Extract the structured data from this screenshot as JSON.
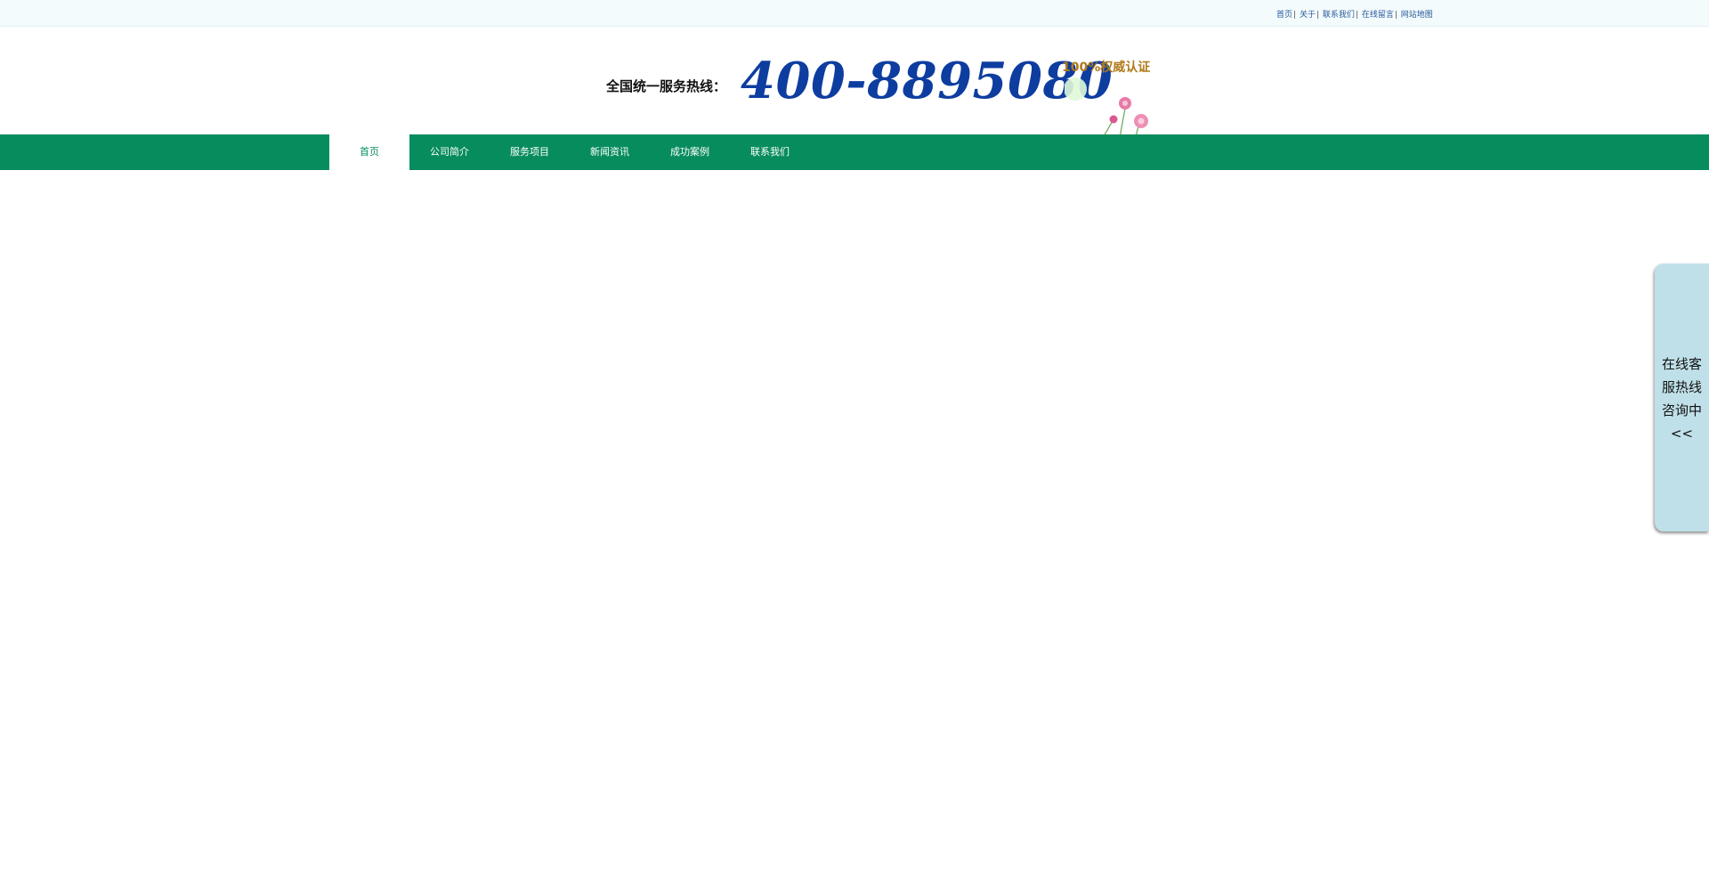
{
  "top_links": [
    "首页",
    "关于",
    "联系我们",
    "在线留言",
    "网站地图"
  ],
  "header": {
    "hotline_label": "全国统一服务热线：",
    "hotline_number": "400-8895080",
    "certification": "100%权威认证"
  },
  "nav": {
    "items": [
      {
        "label": "首页"
      },
      {
        "label": "公司简介"
      },
      {
        "label": "服务项目"
      },
      {
        "label": "新闻资讯"
      },
      {
        "label": "成功案例"
      },
      {
        "label": "联系我们"
      }
    ],
    "active_index": 0
  },
  "side_tab": {
    "lines": [
      "在线客",
      "服热线",
      "咨询中",
      "<<"
    ]
  },
  "colors": {
    "nav_green": "#078c5e",
    "hotline_blue": "#0e3da0",
    "cert_gold": "#b07a1a",
    "side_tab_bg": "#bfe0e8"
  }
}
